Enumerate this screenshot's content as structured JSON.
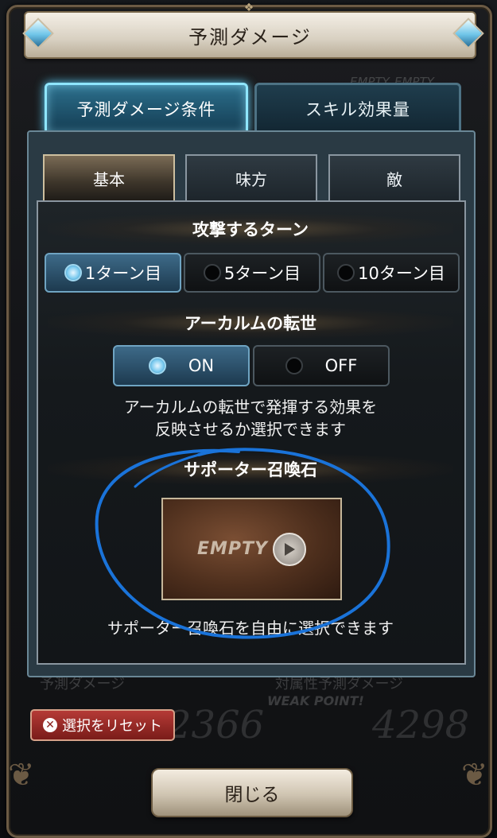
{
  "title": "予測ダメージ",
  "top_tabs": [
    {
      "label": "予測ダメージ条件"
    },
    {
      "label": "スキル効果量"
    }
  ],
  "sub_tabs": [
    {
      "label": "基本"
    },
    {
      "label": "味方"
    },
    {
      "label": "敵"
    }
  ],
  "attack_turn": {
    "heading": "攻撃するターン",
    "options": [
      "1ターン目",
      "5ターン目",
      "10ターン目"
    ],
    "selected": "1ターン目"
  },
  "arcarum": {
    "heading": "アーカルムの転世",
    "options": [
      "ON",
      "OFF"
    ],
    "selected": "ON",
    "description_line1": "アーカルムの転世で発揮する効果を",
    "description_line2": "反映させるか選択できます"
  },
  "supporter": {
    "heading": "サポーター召喚石",
    "slot_label": "EMPTY",
    "description": "サポーター召喚石を自由に選択できます"
  },
  "background": {
    "label_left": "予測ダメージ",
    "label_right": "対属性予測ダメージ",
    "weak_point": "WEAK POINT!",
    "number_left": "2366",
    "number_right": "4298",
    "empty_left": "EMPTY",
    "empty_right": "EMPTY"
  },
  "reset_label": "選択をリセット",
  "close_label": "閉じる",
  "colors": {
    "active_tab_glow": "#8fe6ff",
    "annotation": "#1a73d9",
    "reset_red": "#b53a36"
  }
}
